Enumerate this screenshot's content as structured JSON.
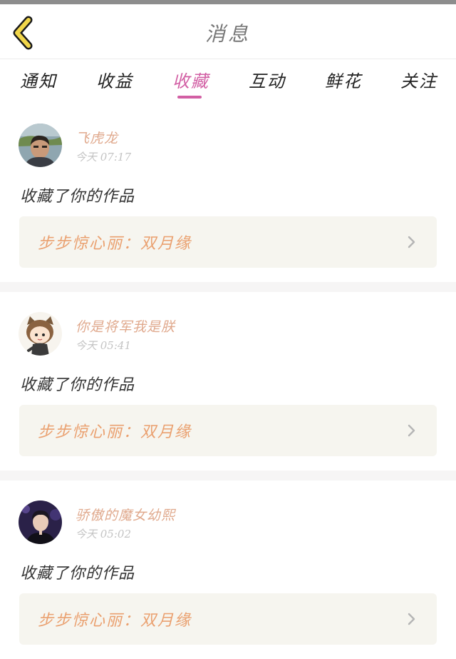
{
  "header": {
    "title": "消息"
  },
  "tabs": [
    {
      "label": "通知"
    },
    {
      "label": "收益"
    },
    {
      "label": "收藏"
    },
    {
      "label": "互动"
    },
    {
      "label": "鲜花"
    },
    {
      "label": "关注"
    }
  ],
  "active_tab": "收藏",
  "colors": {
    "accent": "#d25fa4",
    "username": "#e0a98d",
    "work_title": "#eaa06f",
    "card_bg": "#f6f5ef",
    "back_icon": "#f1d64a"
  },
  "messages": [
    {
      "username": "飞虎龙",
      "time": "今天 07:17",
      "text": "收藏了你的作品",
      "work_title": "步步惊心丽：双月缘",
      "avatar_icon": "man-photo-avatar"
    },
    {
      "username": "你是将军我是朕",
      "time": "今天 05:41",
      "text": "收藏了你的作品",
      "work_title": "步步惊心丽：双月缘",
      "avatar_icon": "cartoon-girl-avatar"
    },
    {
      "username": "骄傲的魔女幼熙",
      "time": "今天 05:02",
      "text": "收藏了你的作品",
      "work_title": "步步惊心丽：双月缘",
      "avatar_icon": "boy-photo-avatar"
    }
  ]
}
